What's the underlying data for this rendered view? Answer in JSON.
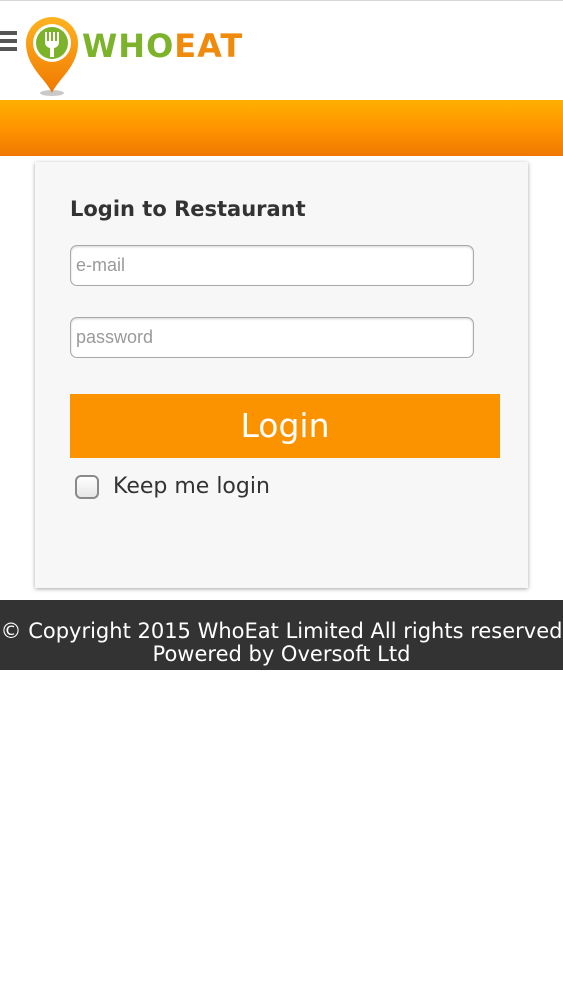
{
  "header": {
    "logo_text_who": "WHO",
    "logo_text_eat": "EAT"
  },
  "colors": {
    "brand_orange": "#fb9300",
    "brand_green": "#7cb32a",
    "footer_bg": "#333333"
  },
  "icons": {
    "menu": "hamburger-menu-icon",
    "logo": "fork-location-pin-icon",
    "checkbox": "checkbox-unchecked"
  },
  "login": {
    "title": "Login to Restaurant",
    "email_placeholder": "e-mail",
    "email_value": "",
    "password_placeholder": "password",
    "password_value": "",
    "button_label": "Login",
    "keep_label": "Keep me login",
    "keep_checked": false
  },
  "footer": {
    "copyright": "© Copyright 2015 WhoEat Limited All rights reserved",
    "powered_by": "Powered by Oversoft Ltd"
  }
}
